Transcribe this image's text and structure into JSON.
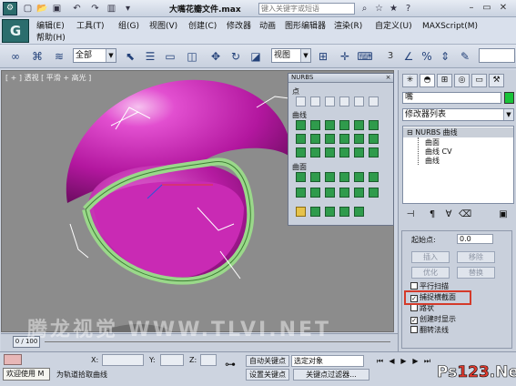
{
  "titlebar": {
    "file_title": "大嘴花瓣文件.max",
    "search_placeholder": "键入关键字或短语",
    "icons": [
      "app-logo",
      "new-icon",
      "open-icon",
      "save-icon",
      "undo-icon",
      "redo-icon",
      "help-icon",
      "minimize-icon",
      "maximize-icon",
      "close-icon"
    ]
  },
  "menubar": {
    "logo": "G",
    "items": [
      "编辑(E)",
      "工具(T)",
      "组(G)",
      "视图(V)",
      "创建(C)",
      "修改器",
      "动画",
      "图形编辑器",
      "渲染(R)",
      "自定义(U)",
      "MAXScript(M)",
      "帮助(H)"
    ]
  },
  "toolbar": {
    "selection_filter": "全部",
    "reference_coord": "视图",
    "snap_value": "3"
  },
  "viewport": {
    "label": "[ + ] 透视 [ 平滑 + 高光 ]"
  },
  "nurbs_panel": {
    "title": "NURBS",
    "close": "×",
    "section_point": "点",
    "section_curve": "曲线",
    "section_surface": "曲面"
  },
  "command_panel": {
    "object_name": "嘴",
    "object_color": "#19c33a",
    "modifier_list": "修改器列表",
    "stack_root": "NURBS 曲线",
    "stack_children": [
      "曲面",
      "曲线 CV",
      "曲线"
    ],
    "start_point_label": "起始点:",
    "start_point_value": "0.0",
    "buttons": {
      "insert": "插入",
      "remove": "移除",
      "optimize": "优化",
      "replace": "替换"
    },
    "checkboxes": [
      {
        "label": "平行扫描",
        "checked": false
      },
      {
        "label": "捕捉横截面",
        "checked": true
      },
      {
        "label": "路状",
        "checked": false
      },
      {
        "label": "创建时显示",
        "checked": true
      },
      {
        "label": "翻转法线",
        "checked": false
      }
    ]
  },
  "timeslider": {
    "frame": "0 / 100"
  },
  "statusbar": {
    "welcome": "欢迎使用 M",
    "prompt": "为轨道拾取曲线",
    "x_label": "X:",
    "y_label": "Y:",
    "z_label": "Z:",
    "auto_key": "自动关键点",
    "set_key": "设置关键点",
    "selected_object": "选定对象",
    "key_filters": "关键点过滤器..."
  },
  "watermark": "腾龙视觉 WWW.TLVI.NET",
  "logo": {
    "ps": "Ps",
    "num": "123",
    "net": ".Net"
  }
}
